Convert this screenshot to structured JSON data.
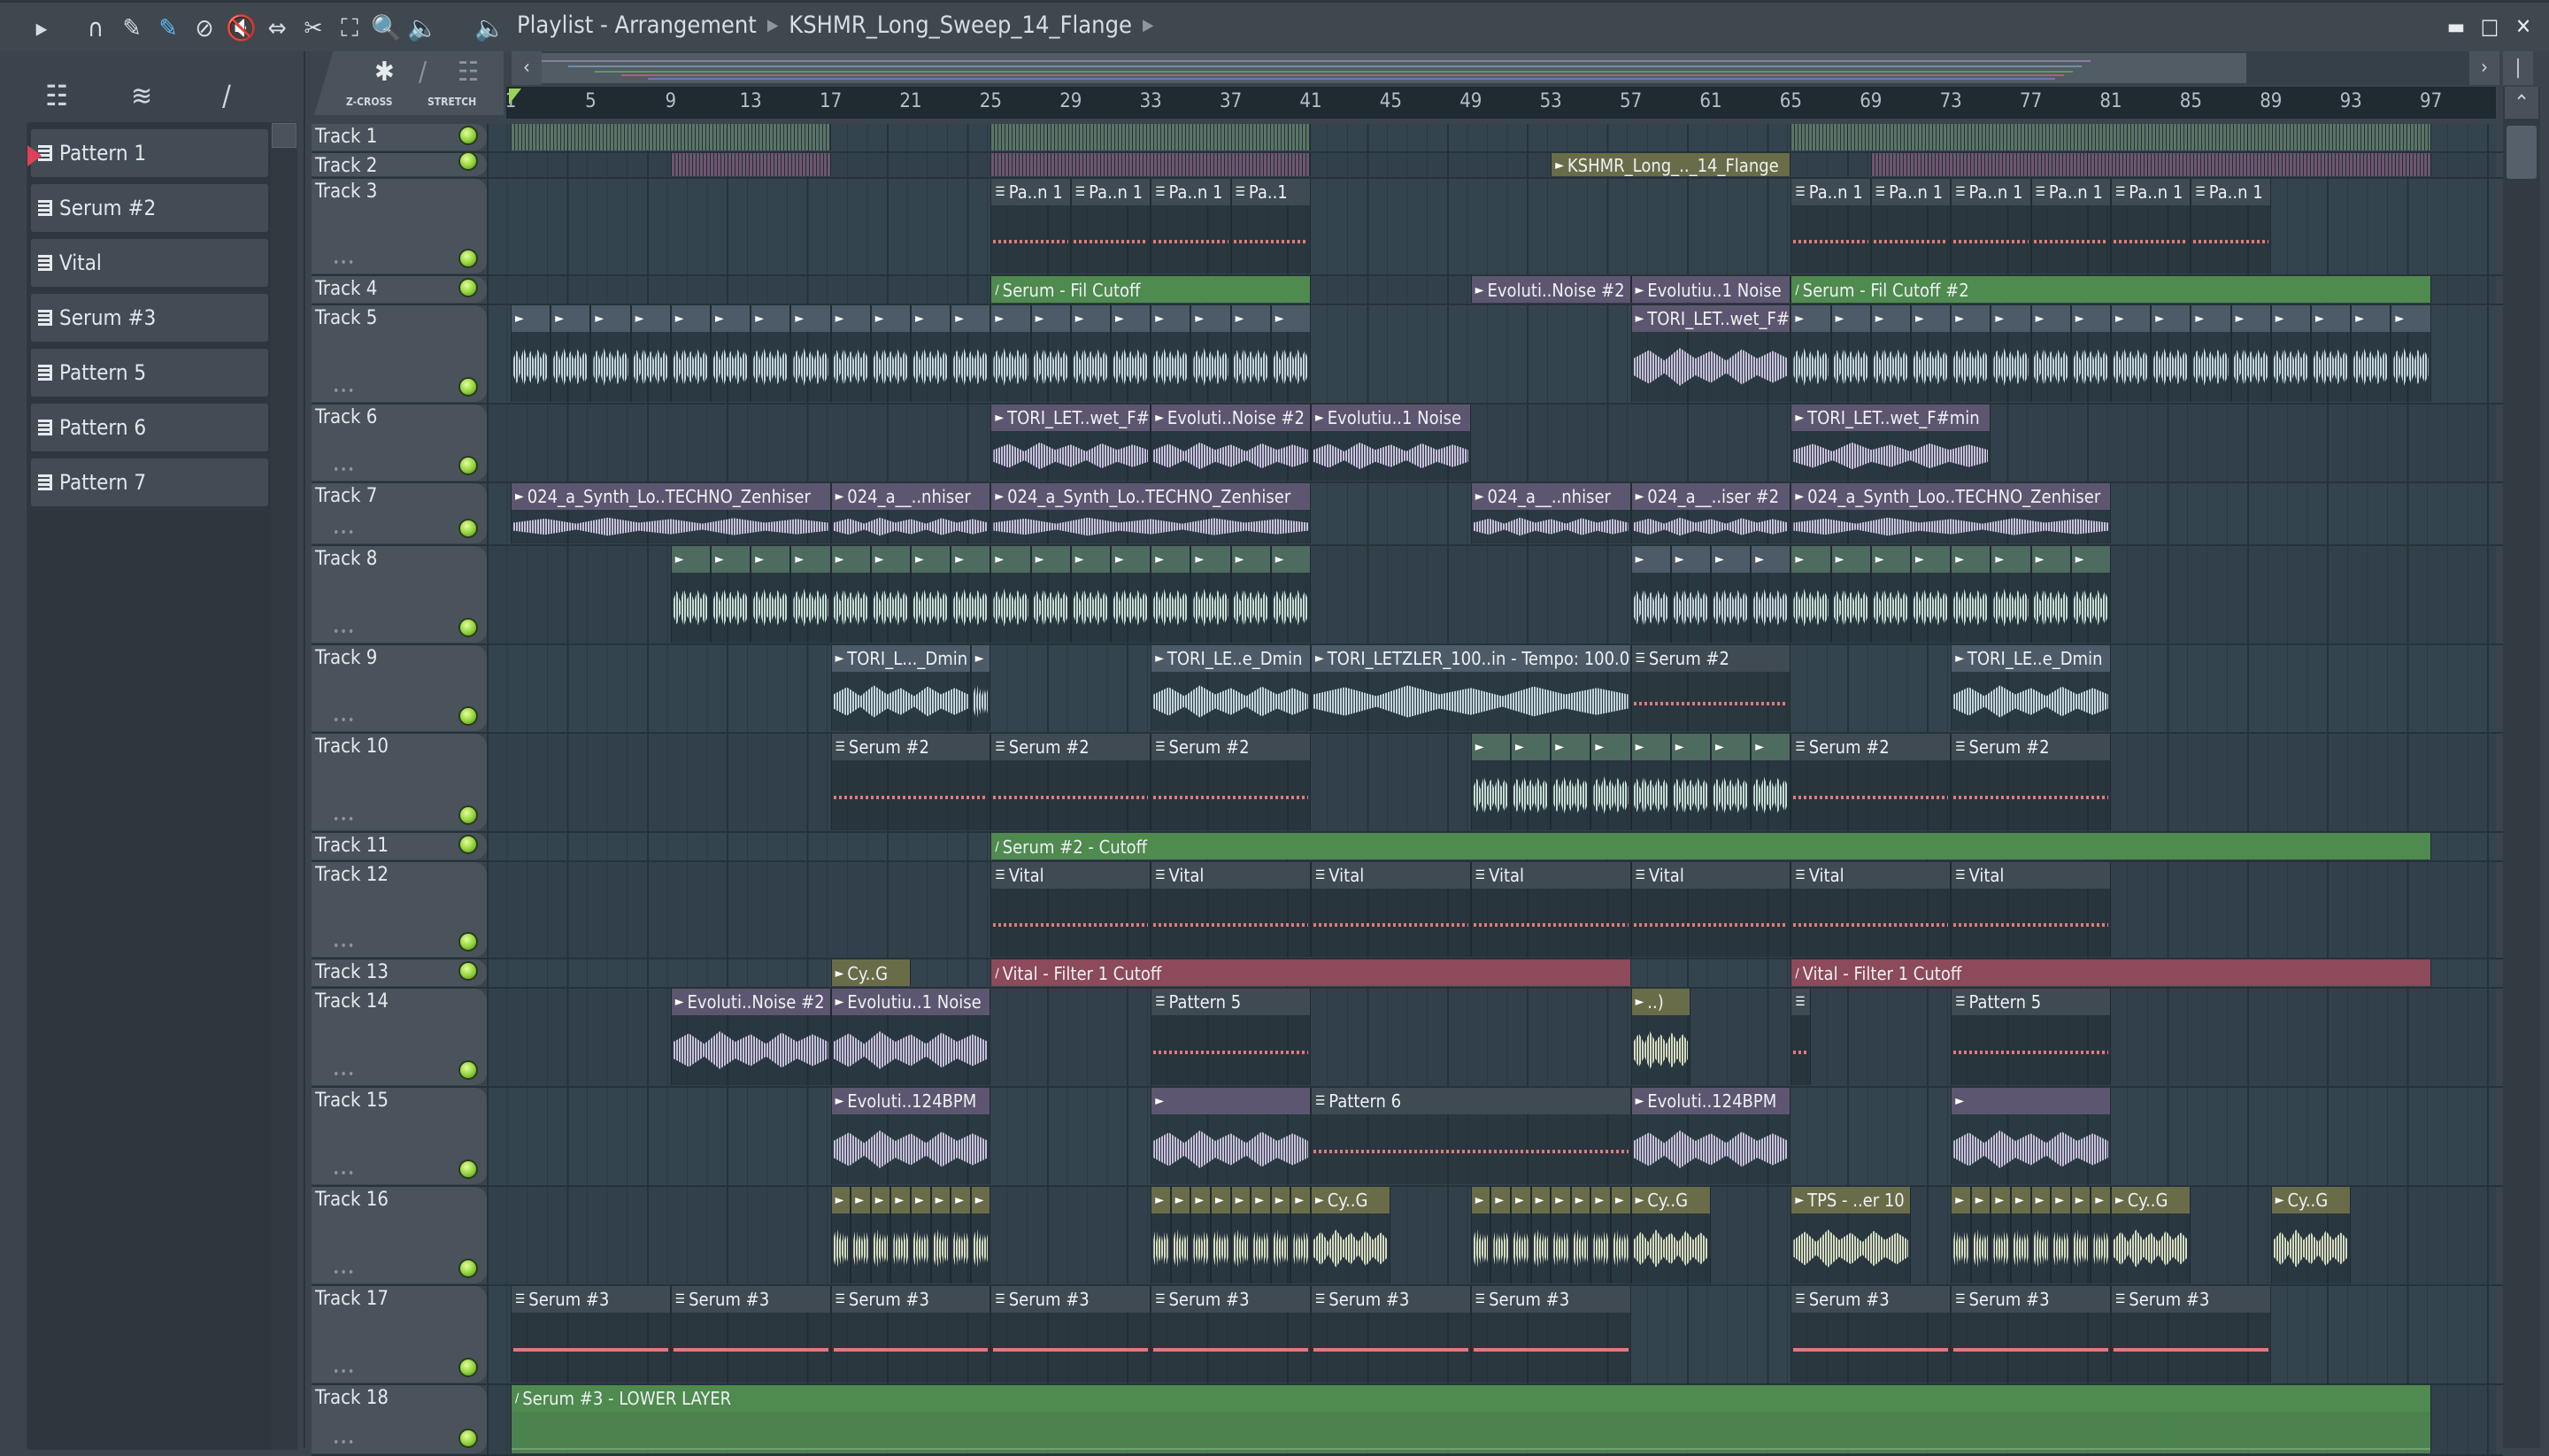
{
  "titlebar": {
    "icons": [
      "play-arrow-icon",
      "magnet-icon",
      "pencil-icon",
      "paint-brush-icon",
      "delete-icon",
      "mute-icon",
      "slip-icon",
      "slice-icon",
      "select-icon",
      "zoom-icon",
      "playback-icon"
    ],
    "speaker_icon": "speaker-icon",
    "breadcrumb": [
      "Playlist - Arrangement",
      "KSHMR_Long_Sweep_14_Flange"
    ]
  },
  "toolpanel": {
    "zcross": "Z-CROSS",
    "stretch": "STRETCH"
  },
  "patterns": [
    "Pattern 1",
    "Serum #2",
    "Vital",
    "Serum #3",
    "Pattern 5",
    "Pattern 6",
    "Pattern 7"
  ],
  "selected_pattern": "Pattern 1",
  "ruler": [
    "1",
    "5",
    "9",
    "13",
    "17",
    "21",
    "25",
    "29",
    "33",
    "37",
    "41",
    "45",
    "49",
    "53",
    "57",
    "61",
    "65",
    "69",
    "73",
    "77",
    "81",
    "85",
    "89",
    "93",
    "97"
  ],
  "tracks": [
    "Track 1",
    "Track 2",
    "Track 3",
    "Track 4",
    "Track 5",
    "Track 6",
    "Track 7",
    "Track 8",
    "Track 9",
    "Track 10",
    "Track 11",
    "Track 12",
    "Track 13",
    "Track 14",
    "Track 15",
    "Track 16",
    "Track 17",
    "Track 18"
  ],
  "colors": {
    "audio": "#5d5670",
    "audioblue": "#4d5a68",
    "greenaudio": "#4d6b5e",
    "pattern": "#3f4a52",
    "auto": "#4f8a4f",
    "autored": "#8c4a5a",
    "olive": "#696c48",
    "greenstrip": "#5b7467",
    "purplestrip": "#6d5670"
  },
  "clips": [
    {
      "t": 0,
      "s": 1,
      "l": 16,
      "k": "greenstrip",
      "label": ""
    },
    {
      "t": 0,
      "s": 25,
      "l": 16,
      "k": "greenstrip",
      "label": ""
    },
    {
      "t": 0,
      "s": 65,
      "l": 32,
      "k": "greenstrip",
      "label": ""
    },
    {
      "t": 1,
      "s": 9,
      "l": 8,
      "k": "purplestrip",
      "label": ""
    },
    {
      "t": 1,
      "s": 25,
      "l": 16,
      "k": "purplestrip",
      "label": ""
    },
    {
      "t": 1,
      "s": 53,
      "l": 12,
      "k": "olive",
      "label": "KSHMR_Long_.._14_Flange"
    },
    {
      "t": 1,
      "s": 69,
      "l": 28,
      "k": "purplestrip",
      "label": ""
    },
    {
      "t": 2,
      "s": 25,
      "l": 4,
      "k": "pattern",
      "label": "Pa..n 1"
    },
    {
      "t": 2,
      "s": 29,
      "l": 4,
      "k": "pattern",
      "label": "Pa..n 1"
    },
    {
      "t": 2,
      "s": 33,
      "l": 4,
      "k": "pattern",
      "label": "Pa..n 1"
    },
    {
      "t": 2,
      "s": 37,
      "l": 4,
      "k": "pattern",
      "label": "Pa..1"
    },
    {
      "t": 2,
      "s": 65,
      "l": 4,
      "k": "pattern",
      "label": "Pa..n 1"
    },
    {
      "t": 2,
      "s": 69,
      "l": 4,
      "k": "pattern",
      "label": "Pa..n 1"
    },
    {
      "t": 2,
      "s": 73,
      "l": 4,
      "k": "pattern",
      "label": "Pa..n 1"
    },
    {
      "t": 2,
      "s": 77,
      "l": 4,
      "k": "pattern",
      "label": "Pa..n 1"
    },
    {
      "t": 2,
      "s": 81,
      "l": 4,
      "k": "pattern",
      "label": "Pa..n 1"
    },
    {
      "t": 2,
      "s": 85,
      "l": 4,
      "k": "pattern",
      "label": "Pa..n 1"
    },
    {
      "t": 3,
      "s": 25,
      "l": 16,
      "k": "auto",
      "label": "Serum - Fil Cutoff"
    },
    {
      "t": 3,
      "s": 49,
      "l": 8,
      "k": "audio",
      "label": "Evoluti..Noise #2"
    },
    {
      "t": 3,
      "s": 57,
      "l": 8,
      "k": "audio",
      "label": "Evolutiu..1 Noise"
    },
    {
      "t": 3,
      "s": 65,
      "l": 32,
      "k": "auto",
      "label": "Serum - Fil Cutoff #2"
    },
    {
      "t": 4,
      "s": 1,
      "l": 2,
      "r": 12,
      "k": "audioblue",
      "label": ""
    },
    {
      "t": 4,
      "s": 25,
      "l": 2,
      "r": 8,
      "k": "audioblue",
      "label": ""
    },
    {
      "t": 4,
      "s": 57,
      "l": 8,
      "k": "audio",
      "label": "TORI_LET..wet_F#min"
    },
    {
      "t": 4,
      "s": 65,
      "l": 2,
      "r": 16,
      "k": "audioblue",
      "label": ""
    },
    {
      "t": 5,
      "s": 25,
      "l": 8,
      "k": "audio",
      "label": "TORI_LET..wet_F#min"
    },
    {
      "t": 5,
      "s": 33,
      "l": 8,
      "k": "audio",
      "label": "Evoluti..Noise #2"
    },
    {
      "t": 5,
      "s": 41,
      "l": 8,
      "k": "audio",
      "label": "Evolutiu..1 Noise"
    },
    {
      "t": 5,
      "s": 65,
      "l": 10,
      "k": "audio",
      "label": "TORI_LET..wet_F#min"
    },
    {
      "t": 6,
      "s": 1,
      "l": 16,
      "k": "audio",
      "label": "024_a_Synth_Lo..TECHNO_Zenhiser"
    },
    {
      "t": 6,
      "s": 17,
      "l": 8,
      "k": "audio",
      "label": "024_a__..nhiser"
    },
    {
      "t": 6,
      "s": 25,
      "l": 16,
      "k": "audio",
      "label": "024_a_Synth_Lo..TECHNO_Zenhiser"
    },
    {
      "t": 6,
      "s": 49,
      "l": 8,
      "k": "audio",
      "label": "024_a__..nhiser"
    },
    {
      "t": 6,
      "s": 57,
      "l": 8,
      "k": "audio",
      "label": "024_a__..iser #2"
    },
    {
      "t": 6,
      "s": 65,
      "l": 16,
      "k": "audio",
      "label": "024_a_Synth_Loo..TECHNO_Zenhiser"
    },
    {
      "t": 7,
      "s": 9,
      "l": 2,
      "r": 8,
      "k": "greenaudio",
      "label": ""
    },
    {
      "t": 7,
      "s": 25,
      "l": 2,
      "r": 8,
      "k": "greenaudio",
      "label": ""
    },
    {
      "t": 7,
      "s": 57,
      "l": 2,
      "r": 4,
      "k": "audioblue",
      "label": ""
    },
    {
      "t": 7,
      "s": 65,
      "l": 2,
      "r": 8,
      "k": "greenaudio",
      "label": ""
    },
    {
      "t": 8,
      "s": 17,
      "l": 7,
      "k": "audioblue",
      "label": "TORI_L..._Dmin"
    },
    {
      "t": 8,
      "s": 24,
      "l": 1,
      "k": "audioblue",
      "label": ""
    },
    {
      "t": 8,
      "s": 33,
      "l": 8,
      "k": "audioblue",
      "label": "TORI_LE..e_Dmin"
    },
    {
      "t": 8,
      "s": 41,
      "l": 16,
      "k": "audioblue",
      "label": "TORI_LETZLER_100..in - Tempo: 100.0"
    },
    {
      "t": 8,
      "s": 57,
      "l": 8,
      "k": "pattern",
      "label": "Serum #2"
    },
    {
      "t": 8,
      "s": 73,
      "l": 8,
      "k": "audioblue",
      "label": "TORI_LE..e_Dmin"
    },
    {
      "t": 9,
      "s": 17,
      "l": 8,
      "k": "pattern",
      "label": "Serum #2"
    },
    {
      "t": 9,
      "s": 25,
      "l": 8,
      "k": "pattern",
      "label": "Serum #2"
    },
    {
      "t": 9,
      "s": 33,
      "l": 8,
      "k": "pattern",
      "label": "Serum #2"
    },
    {
      "t": 9,
      "s": 49,
      "l": 2,
      "r": 8,
      "k": "greenaudio",
      "label": ""
    },
    {
      "t": 9,
      "s": 65,
      "l": 8,
      "k": "pattern",
      "label": "Serum #2"
    },
    {
      "t": 9,
      "s": 73,
      "l": 8,
      "k": "pattern",
      "label": "Serum #2"
    },
    {
      "t": 10,
      "s": 25,
      "l": 72,
      "k": "auto",
      "label": "Serum #2 - Cutoff"
    },
    {
      "t": 11,
      "s": 25,
      "l": 8,
      "k": "pattern",
      "label": "Vital"
    },
    {
      "t": 11,
      "s": 33,
      "l": 8,
      "k": "pattern",
      "label": "Vital"
    },
    {
      "t": 11,
      "s": 41,
      "l": 8,
      "k": "pattern",
      "label": "Vital"
    },
    {
      "t": 11,
      "s": 49,
      "l": 8,
      "k": "pattern",
      "label": "Vital"
    },
    {
      "t": 11,
      "s": 57,
      "l": 8,
      "k": "pattern",
      "label": "Vital"
    },
    {
      "t": 11,
      "s": 65,
      "l": 8,
      "k": "pattern",
      "label": "Vital"
    },
    {
      "t": 11,
      "s": 73,
      "l": 8,
      "k": "pattern",
      "label": "Vital"
    },
    {
      "t": 12,
      "s": 17,
      "l": 4,
      "k": "olive",
      "label": "Cy..G"
    },
    {
      "t": 12,
      "s": 25,
      "l": 32,
      "k": "autored",
      "label": "Vital - Filter 1 Cutoff"
    },
    {
      "t": 12,
      "s": 65,
      "l": 32,
      "k": "autored",
      "label": "Vital - Filter 1 Cutoff"
    },
    {
      "t": 13,
      "s": 9,
      "l": 8,
      "k": "audio",
      "label": "Evoluti..Noise #2"
    },
    {
      "t": 13,
      "s": 17,
      "l": 8,
      "k": "audio",
      "label": "Evolutiu..1 Noise"
    },
    {
      "t": 13,
      "s": 33,
      "l": 8,
      "k": "pattern",
      "label": "Pattern 5"
    },
    {
      "t": 13,
      "s": 57,
      "l": 3,
      "k": "olive",
      "label": "..)"
    },
    {
      "t": 13,
      "s": 65,
      "l": 1,
      "k": "pattern",
      "label": ""
    },
    {
      "t": 13,
      "s": 73,
      "l": 8,
      "k": "pattern",
      "label": "Pattern 5"
    },
    {
      "t": 14,
      "s": 17,
      "l": 8,
      "k": "audio",
      "label": "Evoluti..124BPM"
    },
    {
      "t": 14,
      "s": 33,
      "l": 8,
      "k": "audio",
      "label": ""
    },
    {
      "t": 14,
      "s": 41,
      "l": 16,
      "k": "pattern",
      "label": "Pattern 6"
    },
    {
      "t": 14,
      "s": 57,
      "l": 8,
      "k": "audio",
      "label": "Evoluti..124BPM"
    },
    {
      "t": 14,
      "s": 73,
      "l": 8,
      "k": "audio",
      "label": ""
    },
    {
      "t": 15,
      "s": 17,
      "l": 1,
      "r": 8,
      "k": "olive",
      "label": ""
    },
    {
      "t": 15,
      "s": 33,
      "l": 1,
      "r": 8,
      "k": "olive",
      "label": ""
    },
    {
      "t": 15,
      "s": 41,
      "l": 4,
      "k": "olive",
      "label": "Cy..G"
    },
    {
      "t": 15,
      "s": 49,
      "l": 1,
      "r": 8,
      "k": "olive",
      "label": ""
    },
    {
      "t": 15,
      "s": 57,
      "l": 4,
      "k": "olive",
      "label": "Cy..G"
    },
    {
      "t": 15,
      "s": 65,
      "l": 6,
      "k": "olive",
      "label": "TPS - ..er 10"
    },
    {
      "t": 15,
      "s": 73,
      "l": 1,
      "r": 8,
      "k": "olive",
      "label": ""
    },
    {
      "t": 15,
      "s": 81,
      "l": 4,
      "k": "olive",
      "label": "Cy..G"
    },
    {
      "t": 15,
      "s": 89,
      "l": 4,
      "k": "olive",
      "label": "Cy..G"
    },
    {
      "t": 16,
      "s": 1,
      "l": 8,
      "k": "pattern",
      "label": "Serum #3"
    },
    {
      "t": 16,
      "s": 9,
      "l": 8,
      "k": "pattern",
      "label": "Serum #3"
    },
    {
      "t": 16,
      "s": 17,
      "l": 8,
      "k": "pattern",
      "label": "Serum #3"
    },
    {
      "t": 16,
      "s": 25,
      "l": 8,
      "k": "pattern",
      "label": "Serum #3"
    },
    {
      "t": 16,
      "s": 33,
      "l": 8,
      "k": "pattern",
      "label": "Serum #3"
    },
    {
      "t": 16,
      "s": 41,
      "l": 8,
      "k": "pattern",
      "label": "Serum #3"
    },
    {
      "t": 16,
      "s": 49,
      "l": 8,
      "k": "pattern",
      "label": "Serum #3"
    },
    {
      "t": 16,
      "s": 65,
      "l": 8,
      "k": "pattern",
      "label": "Serum #3"
    },
    {
      "t": 16,
      "s": 73,
      "l": 8,
      "k": "pattern",
      "label": "Serum #3"
    },
    {
      "t": 16,
      "s": 81,
      "l": 8,
      "k": "pattern",
      "label": "Serum #3"
    },
    {
      "t": 17,
      "s": 1,
      "l": 96,
      "k": "auto",
      "label": "Serum #3 - LOWER LAYER"
    }
  ]
}
